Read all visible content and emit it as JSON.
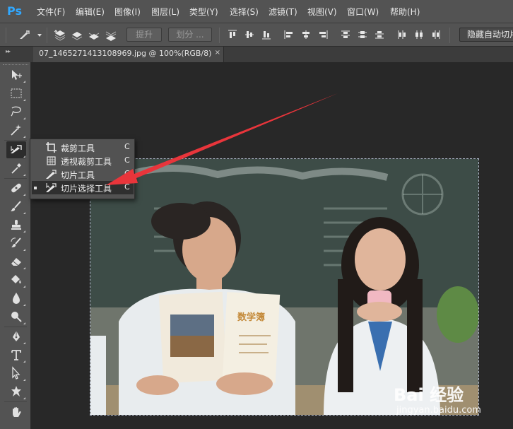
{
  "app": {
    "logo": "Ps"
  },
  "menubar": {
    "items": [
      "文件(F)",
      "编辑(E)",
      "图像(I)",
      "图层(L)",
      "类型(Y)",
      "选择(S)",
      "滤镜(T)",
      "视图(V)",
      "窗口(W)",
      "帮助(H)"
    ]
  },
  "options": {
    "promote_label": "提升",
    "divide_label": "划分 ...",
    "hide_auto_label": "隐藏自动切片"
  },
  "document": {
    "tab_title": "07_1465271413108969.jpg @ 100%(RGB/8)",
    "close_glyph": "×"
  },
  "toolbox": {
    "tools": [
      "move-tool",
      "marquee-tool",
      "lasso-tool",
      "magic-wand-tool",
      "slice-tool",
      "eyedropper-tool",
      "healing-brush-tool",
      "brush-tool",
      "clone-stamp-tool",
      "history-brush-tool",
      "eraser-tool",
      "paint-bucket-tool",
      "blur-tool",
      "dodge-tool",
      "pen-tool",
      "type-tool",
      "path-selection-tool",
      "custom-shape-tool",
      "hand-tool"
    ],
    "collapse_glyph": "▸▸"
  },
  "flyout": {
    "items": [
      {
        "label": "裁剪工具",
        "shortcut": "C",
        "icon": "crop-icon",
        "selected": false
      },
      {
        "label": "透视裁剪工具",
        "shortcut": "C",
        "icon": "perspective-crop-icon",
        "selected": false
      },
      {
        "label": "切片工具",
        "shortcut": "C",
        "icon": "slice-icon",
        "selected": false
      },
      {
        "label": "切片选择工具",
        "shortcut": "C",
        "icon": "slice-select-icon",
        "selected": true
      }
    ]
  },
  "photo": {
    "book_title": "数学簿"
  },
  "watermark": {
    "brand": "Bai 经验",
    "url": "jingyan.baidu.com"
  },
  "colors": {
    "ui_bg": "#535353",
    "canvas_bg": "#282828",
    "annotation_arrow": "#e8353b",
    "ps_blue": "#31a8ff"
  }
}
